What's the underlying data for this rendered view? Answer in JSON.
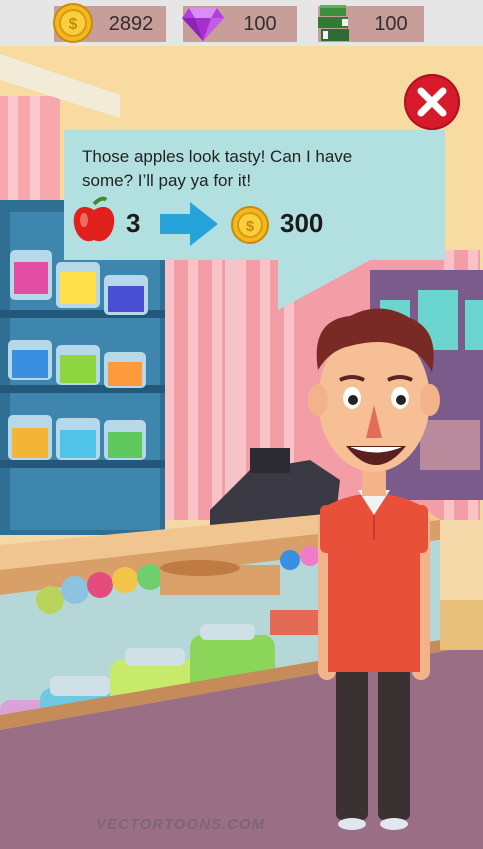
{
  "resources": {
    "coins": "2892",
    "gems": "100",
    "books": "100"
  },
  "offer": {
    "message": "Those apples look tasty! Can I have some? I’ll pay ya for it!",
    "item_icon": "apple-icon",
    "quantity": "3",
    "arrow_icon": "arrow-right-icon",
    "reward_icon": "coin-icon",
    "reward_amount": "300"
  },
  "watermark": "VECTORTOONS.COM",
  "colors": {
    "resource_pill": "#c89e9a",
    "bubble": "#b2e0e0",
    "close_button": "#d71a2a",
    "wall_pink": "#f39ea6",
    "shelf_blue": "#2f6f93",
    "floor": "#9a6f86",
    "shirt": "#e8503a"
  }
}
